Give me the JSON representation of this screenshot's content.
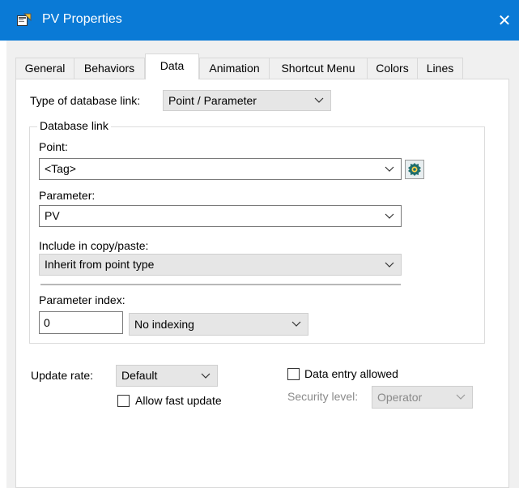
{
  "window": {
    "title": "PV Properties",
    "close_label": "✕"
  },
  "tabs": [
    {
      "label": "General",
      "active": false
    },
    {
      "label": "Behaviors",
      "active": false
    },
    {
      "label": "Data",
      "active": true
    },
    {
      "label": "Animation",
      "active": false
    },
    {
      "label": "Shortcut Menu",
      "active": false
    },
    {
      "label": "Colors",
      "active": false
    },
    {
      "label": "Lines",
      "active": false
    }
  ],
  "data_tab": {
    "link_type_label": "Type of database link:",
    "link_type_value": "Point / Parameter",
    "database_link": {
      "caption": "Database link",
      "point_label": "Point:",
      "point_value": "<Tag>",
      "parameter_label": "Parameter:",
      "parameter_value": "PV",
      "copy_paste_label": "Include in copy/paste:",
      "copy_paste_value": "Inherit from point type",
      "param_index_label": "Parameter index:",
      "param_index_value": "0",
      "indexing_value": "No indexing"
    },
    "update_rate_label": "Update rate:",
    "update_rate_value": "Default",
    "allow_fast_update_label": "Allow fast update",
    "allow_fast_update_checked": false,
    "data_entry_label": "Data entry allowed",
    "data_entry_checked": false,
    "security_level_label": "Security level:",
    "security_level_value": "Operator"
  },
  "colors": {
    "titlebar": "#0a7ad6",
    "panel": "#f0f0f0",
    "disabled_text": "#8a8a8a"
  }
}
